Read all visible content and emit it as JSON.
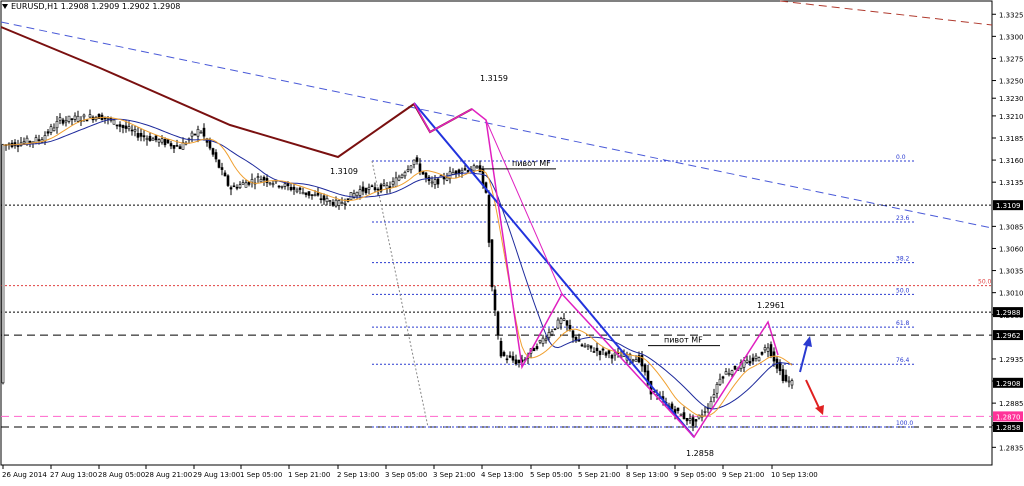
{
  "chart_data": {
    "type": "candlestick",
    "title": "EURUSD,H1",
    "ohlc": [
      "1.2908",
      "1.2909",
      "1.2902",
      "1.2908"
    ],
    "ylim": [
      1.2815,
      1.334
    ],
    "grid": true,
    "y_ticks": [
      "1.3325",
      "1.3300",
      "1.3275",
      "1.3250",
      "1.3230",
      "1.3210",
      "1.3185",
      "1.3160",
      "1.3135",
      "1.3085",
      "1.3060",
      "1.3035",
      "1.3010",
      "1.2985",
      "1.2935",
      "1.2910",
      "1.2885",
      "1.2860",
      "1.2835"
    ],
    "x_ticks": [
      "26 Aug 2014",
      "27 Aug 13:00",
      "28 Aug 05:00",
      "28 Aug 21:00",
      "29 Aug 13:00",
      "1 Sep 05:00",
      "1 Sep 21:00",
      "2 Sep 13:00",
      "3 Sep 05:00",
      "3 Sep 21:00",
      "4 Sep 13:00",
      "5 Sep 05:00",
      "5 Sep 21:00",
      "8 Sep 13:00",
      "9 Sep 05:00",
      "9 Sep 21:00",
      "10 Sep 13:00"
    ],
    "price_tags": [
      {
        "label": "1.3109",
        "value": 1.3109
      },
      {
        "label": "1.2988",
        "value": 1.2988
      },
      {
        "label": "1.2962",
        "value": 1.2962
      },
      {
        "label": "1.2908",
        "value": 1.2908
      },
      {
        "label": "1.2870",
        "value": 1.287
      },
      {
        "label": "1.2858",
        "value": 1.2858
      }
    ],
    "fibonacci": [
      {
        "label": "0.0",
        "value": 1.3159
      },
      {
        "label": "23.6",
        "value": 1.309
      },
      {
        "label": "38.2",
        "value": 1.3044
      },
      {
        "label": "50.0",
        "value": 1.3008
      },
      {
        "label": "61.8",
        "value": 1.2971
      },
      {
        "label": "76.4",
        "value": 1.2929
      },
      {
        "label": "100.0",
        "value": 1.2858
      }
    ],
    "level_50_label": "50.0",
    "annotations": [
      "1.3159",
      "1.3109",
      "1.2961",
      "1.2858",
      "пивот MF",
      "пивот MF"
    ]
  }
}
